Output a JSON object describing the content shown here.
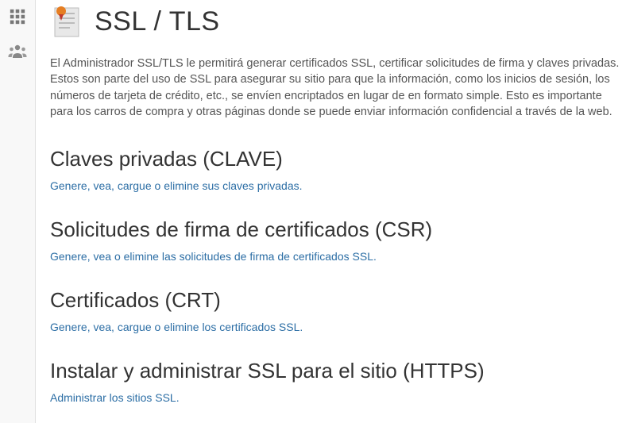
{
  "page": {
    "title": "SSL / TLS",
    "description": "El Administrador SSL/TLS le permitirá generar certificados SSL, certificar solicitudes de firma y claves privadas. Estos son parte del uso de SSL para asegurar su sitio para que la información, como los inicios de sesión, los números de tarjeta de crédito, etc., se envíen encriptados en lugar de en formato simple. Esto es importante para los carros de compra y otras páginas donde se puede enviar información confidencial a través de la web."
  },
  "sections": [
    {
      "heading": "Claves privadas (CLAVE)",
      "link_text": "Genere, vea, cargue o elimine sus claves privadas."
    },
    {
      "heading": "Solicitudes de firma de certificados (CSR)",
      "link_text": "Genere, vea o elimine las solicitudes de firma de certificados SSL."
    },
    {
      "heading": "Certificados (CRT)",
      "link_text": "Genere, vea, cargue o elimine los certificados SSL."
    },
    {
      "heading": "Instalar y administrar SSL para el sitio (HTTPS)",
      "link_text": "Administrar los sitios SSL."
    }
  ]
}
